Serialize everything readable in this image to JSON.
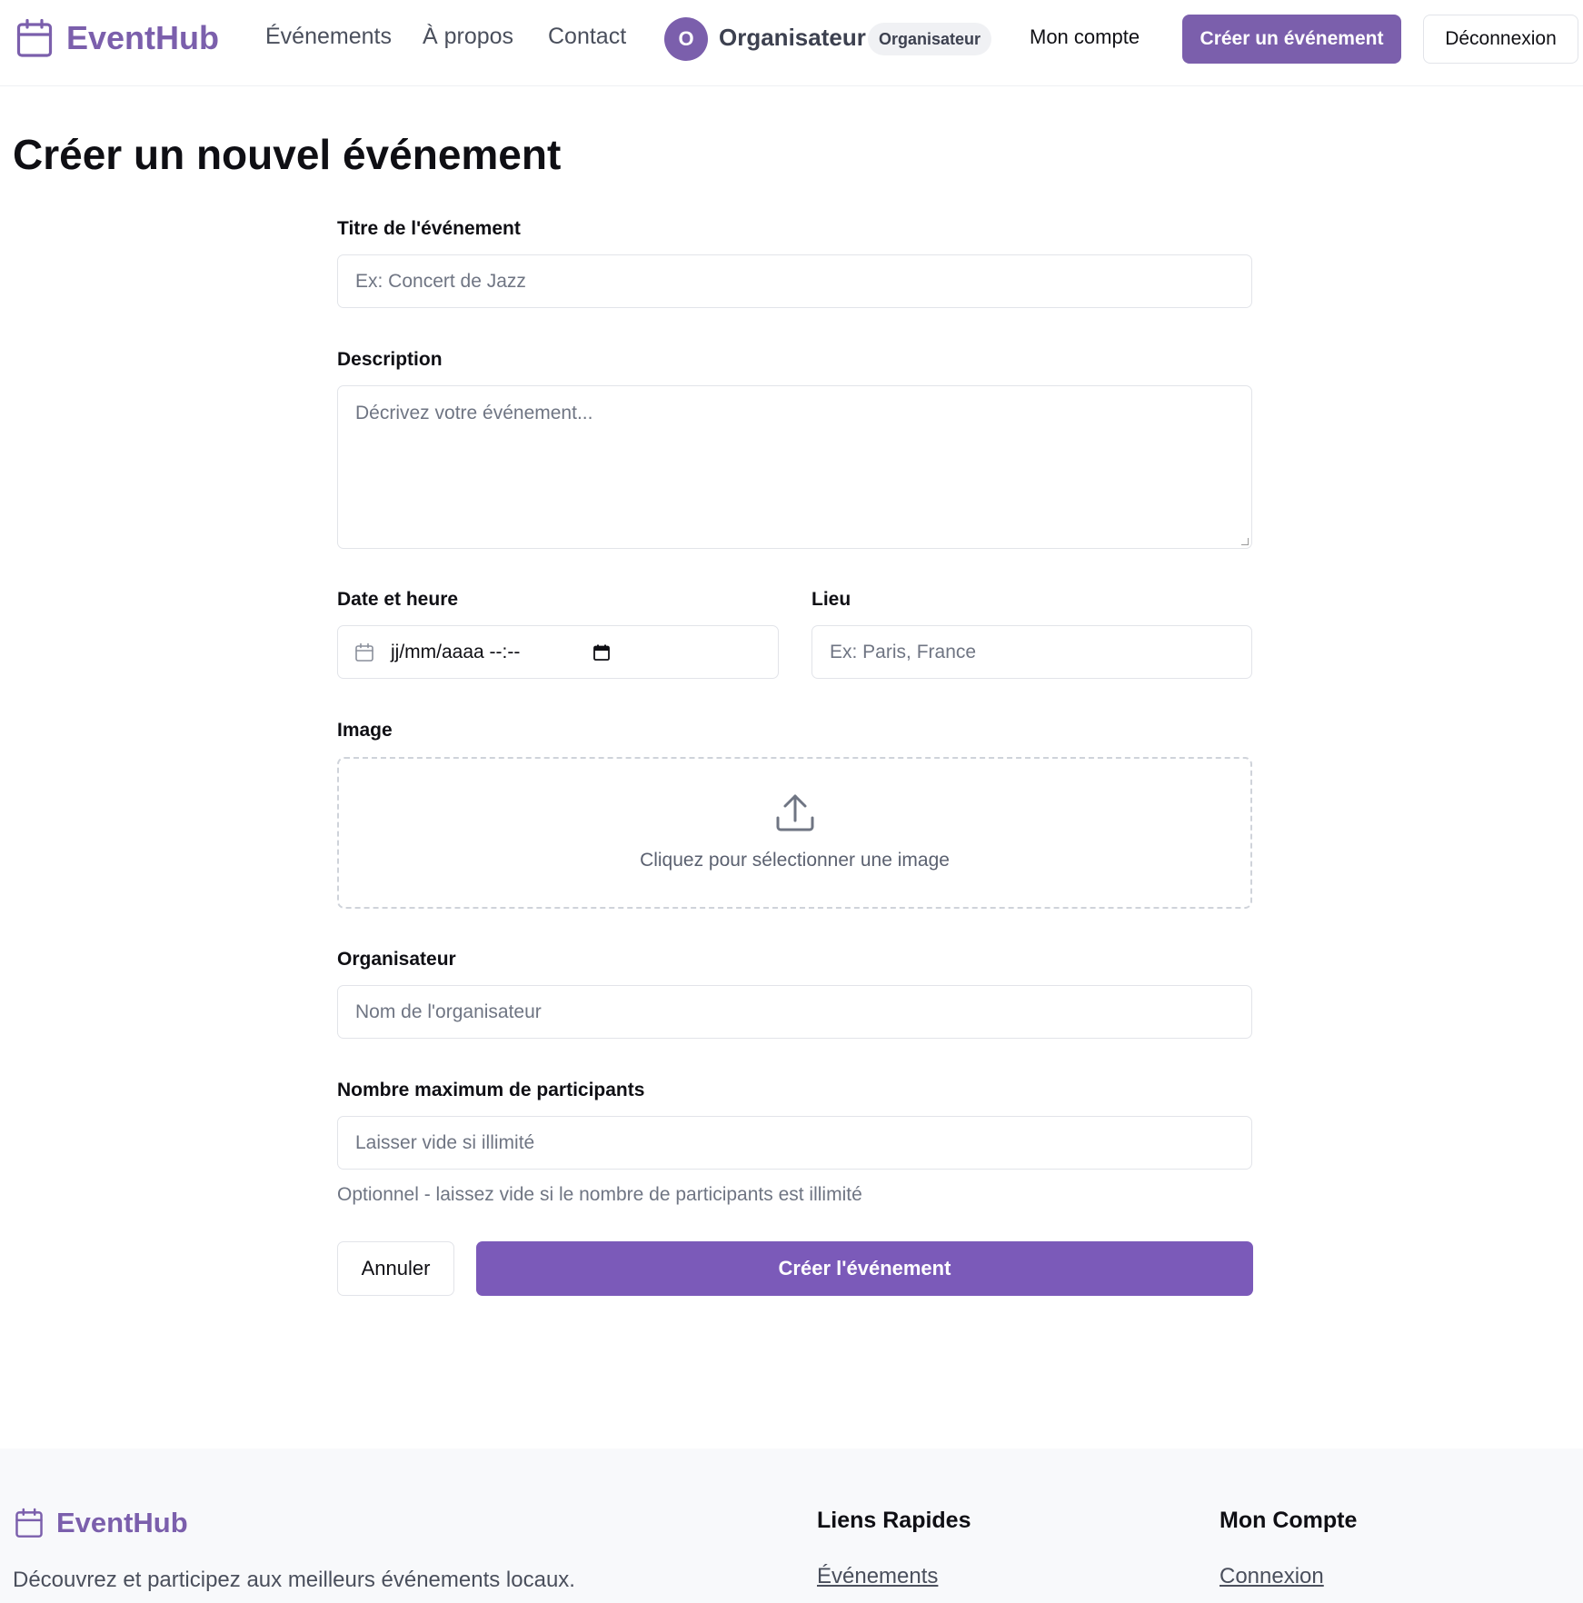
{
  "header": {
    "brand": "EventHub",
    "nav": [
      "Événements",
      "À propos",
      "Contact"
    ],
    "user": {
      "initial": "O",
      "name": "Organisateur",
      "role_badge": "Organisateur"
    },
    "account_link": "Mon compte",
    "create_button": "Créer un événement",
    "logout_button": "Déconnexion"
  },
  "page": {
    "title": "Créer un nouvel événement"
  },
  "form": {
    "title_label": "Titre de l'événement",
    "title_placeholder": "Ex: Concert de Jazz",
    "description_label": "Description",
    "description_placeholder": "Décrivez votre événement...",
    "datetime_label": "Date et heure",
    "datetime_value": "jj/mm/aaaa --:--",
    "location_label": "Lieu",
    "location_placeholder": "Ex: Paris, France",
    "image_label": "Image",
    "image_dropzone_text": "Cliquez pour sélectionner une image",
    "organizer_label": "Organisateur",
    "organizer_placeholder": "Nom de l'organisateur",
    "max_participants_label": "Nombre maximum de participants",
    "max_participants_placeholder": "Laisser vide si illimité",
    "max_participants_help": "Optionnel - laissez vide si le nombre de participants est illimité",
    "cancel_button": "Annuler",
    "submit_button": "Créer l'événement"
  },
  "footer": {
    "brand": "EventHub",
    "tagline": "Découvrez et participez aux meilleurs événements locaux.",
    "quick_links_heading": "Liens Rapides",
    "quick_links": [
      "Événements"
    ],
    "account_heading": "Mon Compte",
    "account_links": [
      "Connexion"
    ]
  },
  "colors": {
    "brand": "#7b5fac",
    "primary_button": "#7b5ab9",
    "border": "#e2e4e9",
    "footer_bg": "#f8f9fb"
  },
  "icons": [
    "calendar-icon",
    "upload-icon",
    "date-picker-icon"
  ]
}
